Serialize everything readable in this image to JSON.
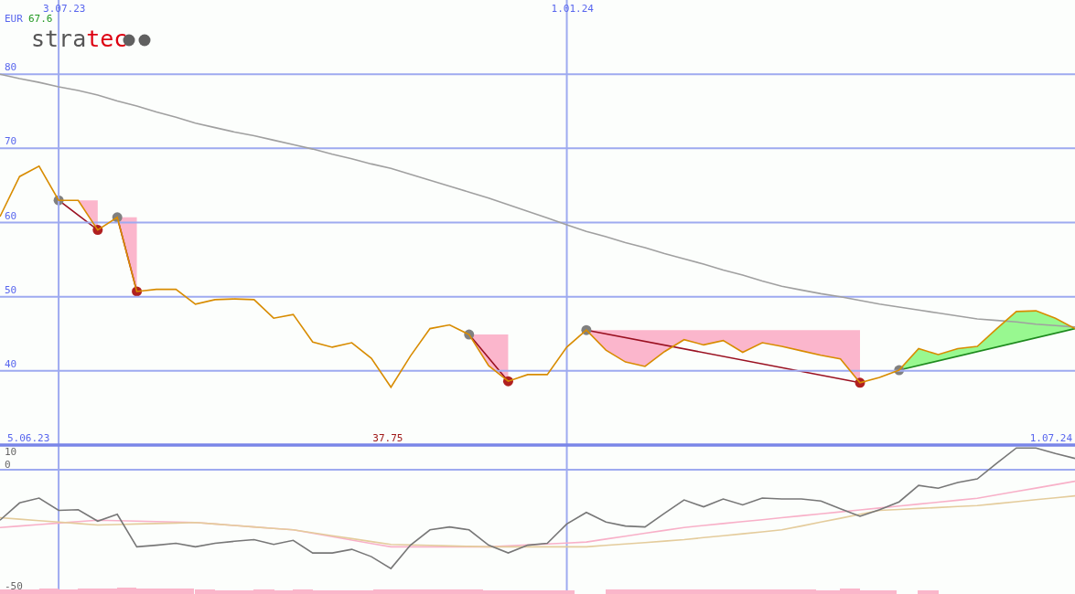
{
  "header": {
    "currency": "EUR",
    "last_value": "67.6"
  },
  "logo": [
    {
      "text": "stra",
      "color": "#555555"
    },
    {
      "text": "tec",
      "color": "#dd0011"
    }
  ],
  "price_chart": {
    "range": {
      "start": "5.06.23",
      "end": "1.07.24"
    },
    "low_label": "37.75",
    "chart_data": {
      "type": "line",
      "grid": true,
      "categories": [
        null,
        null,
        null,
        "3.07.23",
        null,
        null,
        null,
        null,
        null,
        null,
        null,
        null,
        null,
        null,
        null,
        null,
        null,
        null,
        null,
        null,
        null,
        null,
        null,
        null,
        null,
        null,
        null,
        null,
        null,
        "1.01.24",
        null,
        null,
        null,
        null,
        null,
        null,
        null,
        null,
        null,
        null,
        null,
        null,
        null,
        null,
        null,
        null,
        null,
        null,
        null,
        null,
        null,
        null,
        null,
        null,
        null,
        null
      ],
      "ylim": [
        30,
        90
      ],
      "yticks": [
        40,
        50,
        60,
        70,
        80
      ],
      "series": [
        {
          "color": "#d88c00",
          "values": [
            60.8,
            66.2,
            67.6,
            63.0,
            63.0,
            59.0,
            60.7,
            50.7,
            51.0,
            51.0,
            49.0,
            49.6,
            49.7,
            49.6,
            47.1,
            47.6,
            43.9,
            43.2,
            43.8,
            41.7,
            37.8,
            42.0,
            45.7,
            46.2,
            44.9,
            40.7,
            38.6,
            39.5,
            39.5,
            43.2,
            45.5,
            42.8,
            41.2,
            40.6,
            42.6,
            44.2,
            43.5,
            44.1,
            42.5,
            43.8,
            43.3,
            42.7,
            42.1,
            41.6,
            38.4,
            39.1,
            40.1,
            43.0,
            42.2,
            43.0,
            43.3,
            45.7,
            48.0,
            48.1,
            47.1,
            45.7
          ]
        },
        {
          "color": "#a0a0a0",
          "values": [
            80,
            79.4,
            78.9,
            78.3,
            77.8,
            77.2,
            76.4,
            75.7,
            74.9,
            74.2,
            73.4,
            72.8,
            72.2,
            71.7,
            71.1,
            70.5,
            69.9,
            69.2,
            68.6,
            67.9,
            67.3,
            66.5,
            65.7,
            64.9,
            64.1,
            63.3,
            62.4,
            61.5,
            60.6,
            59.7,
            58.8,
            58.1,
            57.3,
            56.6,
            55.8,
            55.1,
            54.4,
            53.6,
            52.9,
            52.1,
            51.4,
            50.9,
            50.4,
            50.0,
            49.5,
            49.0,
            48.6,
            48.2,
            47.8,
            47.4,
            47.0,
            46.8,
            46.6,
            46.3,
            46.1,
            45.9
          ]
        }
      ]
    }
  },
  "oscillator": {
    "top_label": "10",
    "chart_data": {
      "type": "line",
      "ylim": [
        -50,
        7.9
      ],
      "yticks": [
        0,
        -50
      ],
      "categories": [
        null,
        null,
        null,
        null,
        null,
        null,
        null,
        null,
        null,
        null,
        null,
        null,
        null,
        null,
        null,
        null,
        null,
        null,
        null,
        null,
        null,
        null,
        null,
        null,
        null,
        null,
        null,
        null,
        null,
        null,
        null,
        null,
        null,
        null,
        null,
        null,
        null,
        null,
        null,
        null,
        null,
        null,
        null,
        null,
        null,
        null,
        null,
        null,
        null,
        null,
        null,
        null,
        null,
        null,
        null,
        null
      ],
      "series": [
        {
          "color": "#f8b0c8",
          "values": [
            -26,
            -25.4,
            -24.8,
            -24.2,
            -23.6,
            -23,
            -23.2,
            -23.4,
            -23.6,
            -23.8,
            -24,
            -24.6,
            -25.2,
            -25.8,
            -26.4,
            -27,
            -28.4,
            -29.8,
            -31.2,
            -32.6,
            -34,
            -34,
            -34,
            -34,
            -34,
            -34,
            -33.6,
            -33.2,
            -32.8,
            -32.4,
            -32,
            -30.8,
            -29.6,
            -28.4,
            -27.2,
            -26,
            -25.2,
            -24.4,
            -23.6,
            -22.8,
            -22,
            -21.2,
            -20.4,
            -19.6,
            -18.8,
            -18,
            -17.2,
            -16.4,
            -15.6,
            -14.8,
            -14,
            -12.6,
            -11.2,
            -9.8,
            -8.4,
            -7
          ]
        },
        {
          "color": "#e4cc9c",
          "values": [
            -22,
            -22.6,
            -23.2,
            -23.8,
            -24.4,
            -25,
            -24.8,
            -24.6,
            -24.4,
            -24.2,
            -24,
            -24.6,
            -25.2,
            -25.8,
            -26.4,
            -27,
            -28.2,
            -29.4,
            -30.6,
            -31.8,
            -33,
            -33.2,
            -33.4,
            -33.6,
            -33.8,
            -34,
            -34,
            -34,
            -34,
            -34,
            -34,
            -33.4,
            -32.8,
            -32.2,
            -31.6,
            -31,
            -30.2,
            -29.4,
            -28.6,
            -27.8,
            -27,
            -25.4,
            -23.8,
            -22.2,
            -20.6,
            -19,
            -18.6,
            -18.2,
            -17.8,
            -17.4,
            -17,
            -16.2,
            -15.4,
            -14.6,
            -13.8,
            -13
          ]
        },
        {
          "color": "#777777",
          "values": [
            -23,
            -15.9,
            -13.9,
            -19,
            -18.7,
            -23.4,
            -20.6,
            -34,
            -33.3,
            -32.5,
            -34,
            -32.5,
            -31.7,
            -31,
            -33,
            -31.3,
            -36.5,
            -36.5,
            -35,
            -38,
            -42.9,
            -33.3,
            -27,
            -25.8,
            -27,
            -33.3,
            -36.5,
            -33.3,
            -32.5,
            -24.6,
            -19.8,
            -23.8,
            -25.4,
            -25.8,
            -20.2,
            -14.7,
            -17.5,
            -14.3,
            -16.7,
            -13.9,
            -14.3,
            -14.3,
            -15.1,
            -18.3,
            -21.4,
            -18.7,
            -15.5,
            -8.7,
            -9.9,
            -7.5,
            -6,
            0.4,
            6.7,
            6.7,
            4.4,
            2.4
          ]
        }
      ]
    }
  }
}
